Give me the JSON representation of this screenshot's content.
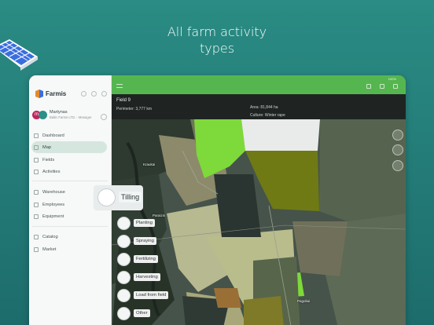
{
  "headline": [
    "All farm activity",
    "types"
  ],
  "app": {
    "name": "Farmis"
  },
  "user": {
    "initial": "m",
    "name": "Martynas",
    "org": "Baltic Farms LTD. - Manager"
  },
  "sidebar": {
    "items": [
      {
        "label": "Dashboard",
        "icon": "dashboard-icon",
        "active": false
      },
      {
        "label": "Map",
        "icon": "map-icon",
        "active": true
      },
      {
        "label": "Fields",
        "icon": "fields-icon",
        "active": false
      },
      {
        "label": "Activities",
        "icon": "activities-icon",
        "active": false
      },
      {
        "label": "Warehouse",
        "icon": "warehouse-icon",
        "active": false
      },
      {
        "label": "Employees",
        "icon": "employees-icon",
        "active": false
      },
      {
        "label": "Equipment",
        "icon": "equipment-icon",
        "active": false
      },
      {
        "label": "Catalog",
        "icon": "catalog-icon",
        "active": false
      },
      {
        "label": "Market",
        "icon": "market-icon",
        "active": false
      }
    ]
  },
  "status": {
    "battery": "100%"
  },
  "field": {
    "title": "Field 9",
    "perimeter": "Perimeter: 3,777 km",
    "area": "Area: 81,844 ha",
    "culture": "Culture: Winter rape"
  },
  "activity_menu": {
    "selected": "Tilling",
    "options": [
      "Planting",
      "Spraying",
      "Fertilizing",
      "Harvesting",
      "Load from field",
      "Other"
    ]
  },
  "colors": {
    "background": "#237a76",
    "topbar": "#55b650",
    "field_bright": "#7ed93a",
    "field_olive": "#6f7a15",
    "field_white": "#e8ebea"
  }
}
